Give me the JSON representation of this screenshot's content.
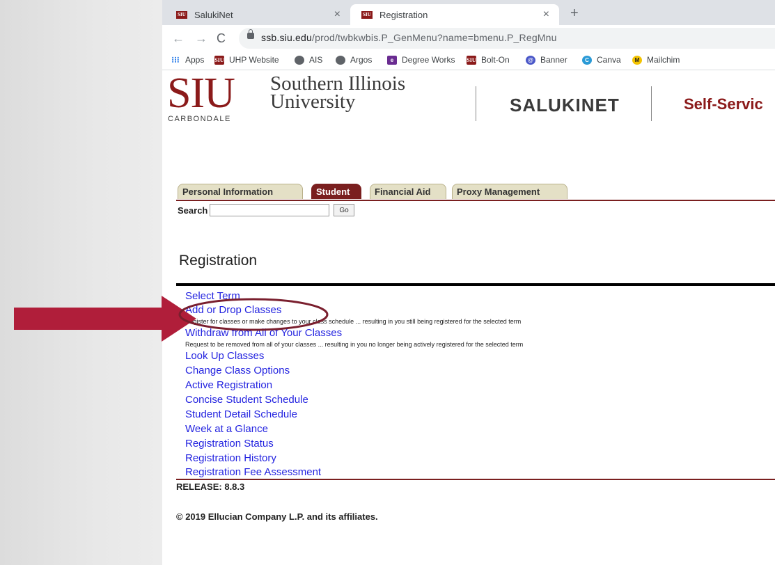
{
  "browser": {
    "tabs": [
      {
        "label": "SalukiNet",
        "favicon": "siu-favicon",
        "close": "×"
      },
      {
        "label": "Registration",
        "favicon": "siu-favicon",
        "close": "×"
      }
    ],
    "new_tab": "+",
    "url_domain": "ssb.siu.edu",
    "url_path": "/prod/twbkwbis.P_GenMenu?name=bmenu.P_RegMnu",
    "nav": {
      "back": "←",
      "forward": "→",
      "reload": "C"
    },
    "bookmarks": [
      {
        "label": "Apps",
        "icon": "apps-grid-icon",
        "glyph": "⁝⁝⁝"
      },
      {
        "label": "UHP Website",
        "icon": "siu-icon",
        "glyph": "SIU"
      },
      {
        "label": "AIS",
        "icon": "globe-icon",
        "glyph": ""
      },
      {
        "label": "Argos",
        "icon": "globe-icon",
        "glyph": ""
      },
      {
        "label": "Degree Works",
        "icon": "degree-works-icon",
        "glyph": "e"
      },
      {
        "label": "Bolt-On",
        "icon": "siu-icon",
        "glyph": "SIU"
      },
      {
        "label": "Banner",
        "icon": "banner-icon",
        "glyph": "@"
      },
      {
        "label": "Canva",
        "icon": "canva-icon",
        "glyph": "C"
      },
      {
        "label": "Mailchim",
        "icon": "mailchimp-icon",
        "glyph": "M"
      }
    ]
  },
  "header": {
    "logo_letters": "SIU",
    "logo_name_line1": "Southern Illinois",
    "logo_name_line2": "University",
    "logo_sub": "CARBONDALE",
    "app_name": "SALUKINET",
    "self_service": "Self-Servic"
  },
  "nav_tabs": [
    {
      "label": "Personal Information",
      "active": false
    },
    {
      "label": "Student",
      "active": true
    },
    {
      "label": "Financial Aid",
      "active": false
    },
    {
      "label": "Proxy Management",
      "active": false
    }
  ],
  "search": {
    "label": "Search",
    "value": "",
    "button": "Go"
  },
  "page_title": "Registration",
  "menu": [
    {
      "label": "Select Term"
    },
    {
      "label": "Add or Drop Classes",
      "desc": "Register for classes or make changes to your class schedule ... resulting in you still being registered for the selected term"
    },
    {
      "label": "Withdraw from All of Your Classes",
      "desc": "Request to be removed from all of your classes ... resulting in you no longer being actively registered for the selected term"
    },
    {
      "label": "Look Up Classes"
    },
    {
      "label": "Change Class Options"
    },
    {
      "label": "Active Registration"
    },
    {
      "label": "Concise Student Schedule"
    },
    {
      "label": "Student Detail Schedule"
    },
    {
      "label": "Week at a Glance"
    },
    {
      "label": "Registration Status"
    },
    {
      "label": "Registration History"
    },
    {
      "label": "Registration Fee Assessment"
    }
  ],
  "footer": {
    "release": "RELEASE: 8.8.3",
    "copyright": "© 2019 Ellucian Company L.P. and its affiliates."
  },
  "colors": {
    "accent": "#7a1f1f",
    "link": "#2323e0",
    "annotation_arrow": "#b01e3a",
    "annotation_circle": "#7a1f2e"
  }
}
